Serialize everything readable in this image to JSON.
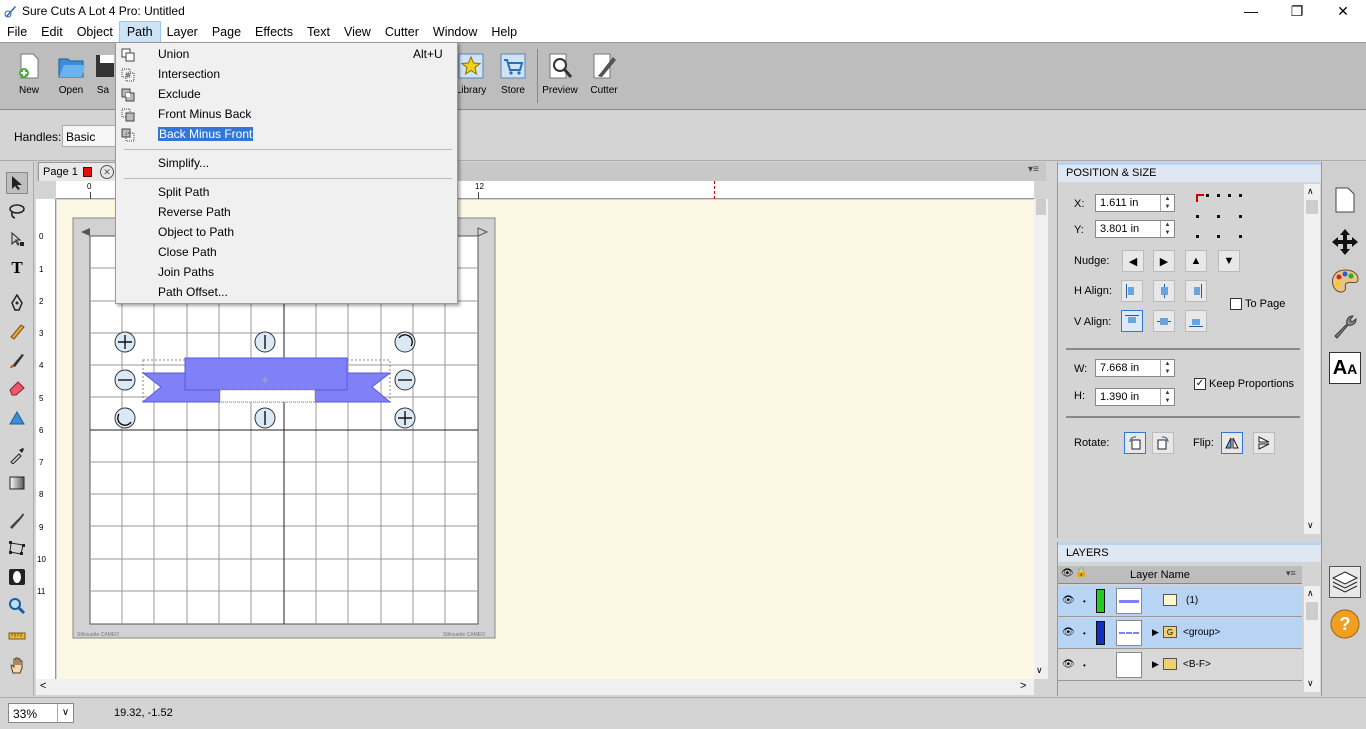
{
  "window": {
    "title": "Sure Cuts A Lot 4 Pro: Untitled"
  },
  "menubar": [
    "File",
    "Edit",
    "Object",
    "Path",
    "Layer",
    "Page",
    "Effects",
    "Text",
    "View",
    "Cutter",
    "Window",
    "Help"
  ],
  "toolbar": {
    "new": "New",
    "open": "Open",
    "save": "Sa",
    "library": "Library",
    "store": "Store",
    "preview": "Preview",
    "cutter": "Cutter"
  },
  "handles": {
    "label": "Handles:",
    "value": "Basic"
  },
  "tabs": {
    "page": "Page 1"
  },
  "ruler": {
    "h": [
      "0",
      "12"
    ],
    "v": [
      "0",
      "1",
      "2",
      "3",
      "4",
      "5",
      "6",
      "7",
      "8",
      "9",
      "10",
      "11"
    ]
  },
  "mat": {
    "watermark_left": "Silhouette CAMEO",
    "watermark_right": "Silhouette CAMEO"
  },
  "path_menu": {
    "items": [
      {
        "label": "Union",
        "shortcut": "Alt+U"
      },
      {
        "label": "Intersection",
        "shortcut": ""
      },
      {
        "label": "Exclude",
        "shortcut": ""
      },
      {
        "label": "Front Minus Back",
        "shortcut": ""
      },
      {
        "label": "Back Minus Front",
        "shortcut": ""
      },
      {
        "label": "Simplify...",
        "shortcut": ""
      },
      {
        "label": "Split Path",
        "shortcut": ""
      },
      {
        "label": "Reverse Path",
        "shortcut": ""
      },
      {
        "label": "Object to Path",
        "shortcut": ""
      },
      {
        "label": "Close Path",
        "shortcut": ""
      },
      {
        "label": "Join Paths",
        "shortcut": ""
      },
      {
        "label": "Path Offset...",
        "shortcut": ""
      }
    ]
  },
  "position_size": {
    "header": "POSITION & SIZE",
    "x_label": "X:",
    "x_value": "1.611 in",
    "y_label": "Y:",
    "y_value": "3.801 in",
    "nudge_label": "Nudge:",
    "halign_label": "H Align:",
    "valign_label": "V Align:",
    "to_page": "To Page",
    "w_label": "W:",
    "w_value": "7.668 in",
    "h_label": "H:",
    "h_value": "1.390 in",
    "keep_proportions": "Keep Proportions",
    "rotate_label": "Rotate:",
    "flip_label": "Flip:"
  },
  "layers": {
    "header": "LAYERS",
    "column": "Layer Name",
    "rows": [
      {
        "name": "(1)",
        "color": "#22cc22"
      },
      {
        "name": "<group>",
        "color": "#1030c0"
      },
      {
        "name": "<B-F>",
        "color": ""
      }
    ]
  },
  "status": {
    "zoom": "33%",
    "coords": "19.32, -1.52"
  },
  "colors": {
    "shape": "#8080f8",
    "accent": "#3377d6"
  }
}
